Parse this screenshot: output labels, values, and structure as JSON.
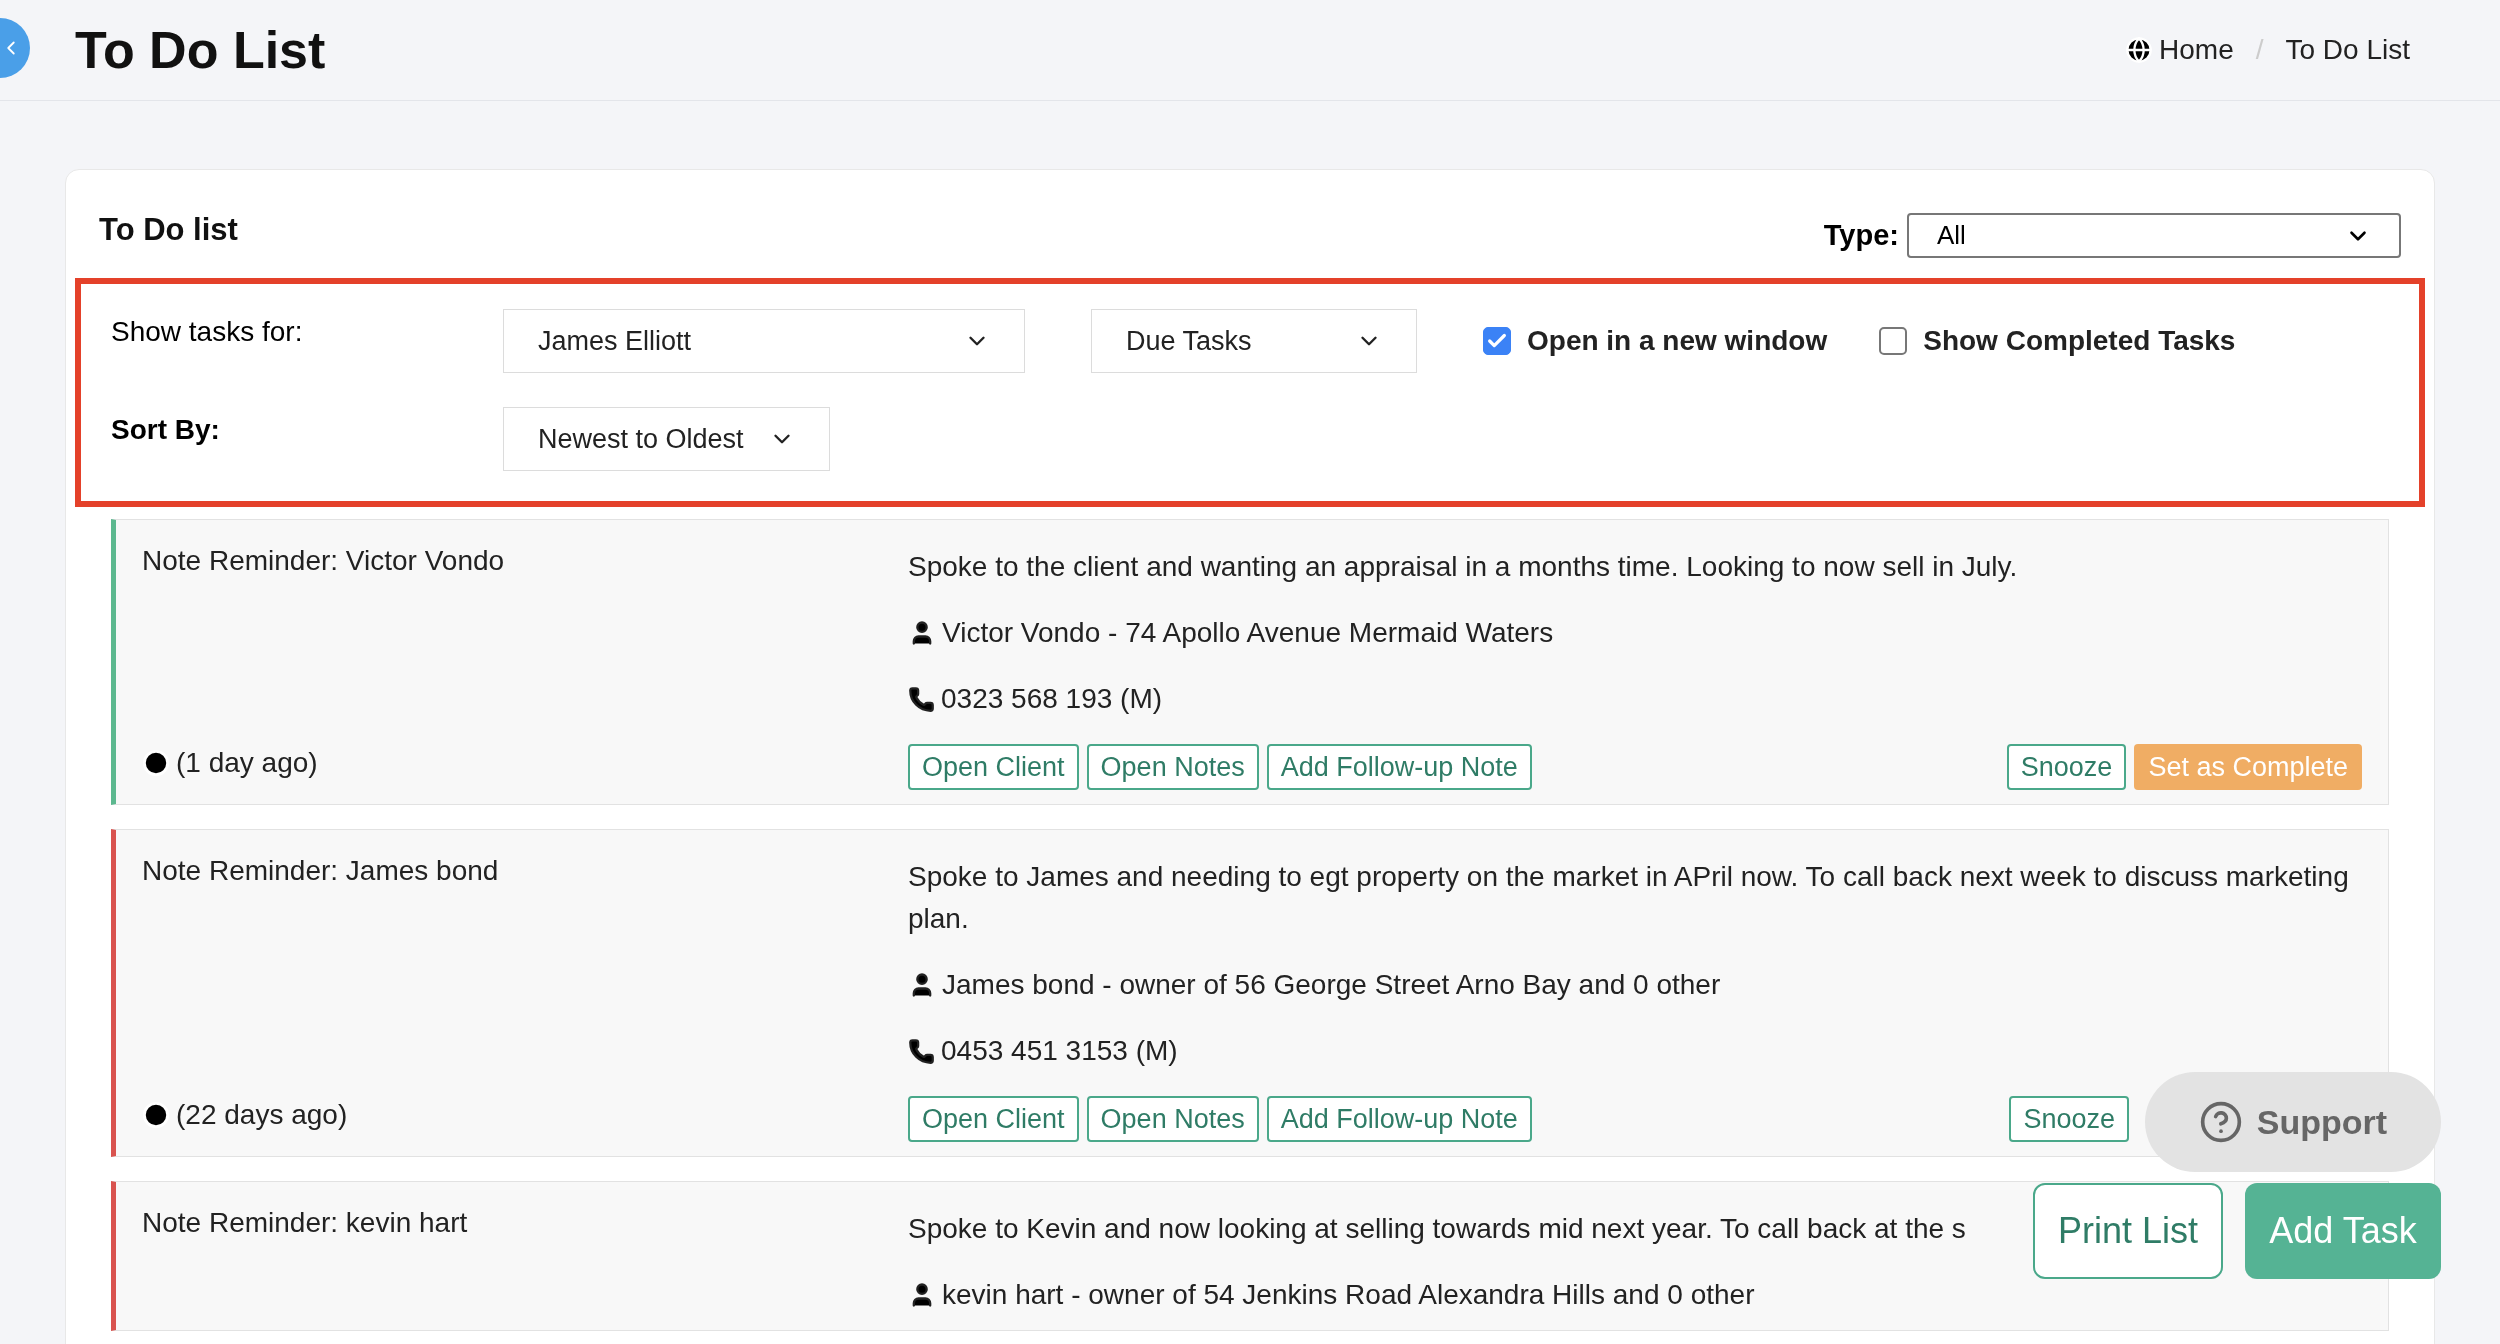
{
  "header": {
    "title": "To Do List",
    "breadcrumb": [
      "Home",
      "To Do List"
    ],
    "separator": "/"
  },
  "panel": {
    "title": "To Do list",
    "type_label": "Type:",
    "type_value": "All"
  },
  "filters": {
    "show_for_label": "Show tasks for:",
    "person": "James Elliott",
    "due": "Due Tasks",
    "open_new_window": {
      "label": "Open in a new window",
      "checked": true
    },
    "show_completed": {
      "label": "Show Completed Tasks",
      "checked": false
    },
    "sort_label": "Sort By:",
    "sort": "Newest to Oldest"
  },
  "tasks": [
    {
      "color": "#5cb88f",
      "title": "Note Reminder: Victor Vondo",
      "age": "(1 day ago)",
      "description": "Spoke to the client and wanting an appraisal in a months time. Looking to now sell in July.",
      "contact": "Victor Vondo - 74 Apollo Avenue Mermaid Waters",
      "phone": "0323 568 193 (M)",
      "actions": [
        "Open Client",
        "Open Notes",
        "Add Follow-up Note"
      ],
      "snooze": "Snooze",
      "complete": "Set as Complete"
    },
    {
      "color": "#d9534f",
      "title": "Note Reminder: James bond",
      "age": "(22 days ago)",
      "description": "Spoke to James and needing to egt property on the market in APril now. To call back next week to discuss marketing plan.",
      "contact": "James bond - owner of 56 George Street Arno Bay and 0 other",
      "phone": "0453 451 3153 (M)",
      "actions": [
        "Open Client",
        "Open Notes",
        "Add Follow-up Note"
      ],
      "snooze": "Snooze"
    },
    {
      "color": "#d9534f",
      "title": "Note Reminder: kevin hart",
      "description": "Spoke to Kevin and now looking at selling towards mid next year. To call back at the s",
      "contact": "kevin hart - owner of 54 Jenkins Road Alexandra Hills and 0 other"
    }
  ],
  "floating": {
    "support": "Support",
    "print": "Print List",
    "add": "Add Task"
  }
}
